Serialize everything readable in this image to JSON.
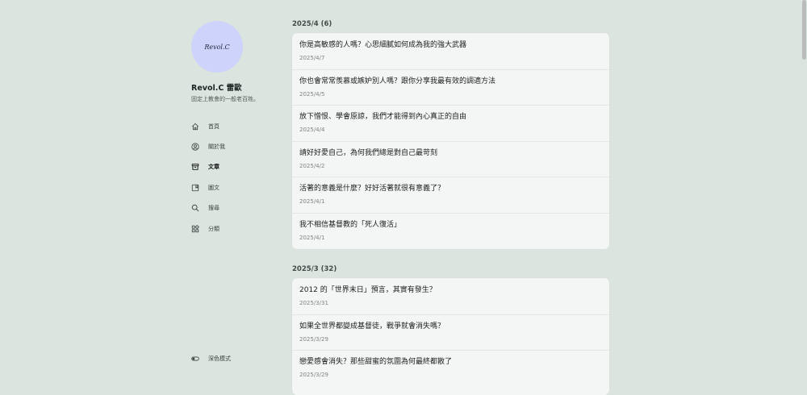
{
  "sidebar": {
    "avatar_text": "Revol.C",
    "site_name": "Revol.C 雷歐",
    "site_desc": "固定上教會的一般老百姓。",
    "nav": [
      {
        "label": "首頁",
        "icon": "home-icon"
      },
      {
        "label": "關於我",
        "icon": "user-circle-icon"
      },
      {
        "label": "文章",
        "icon": "archive-icon"
      },
      {
        "label": "圖文",
        "icon": "photo-icon"
      },
      {
        "label": "搜尋",
        "icon": "search-icon"
      },
      {
        "label": "分類",
        "icon": "categories-icon"
      }
    ],
    "active_nav": "文章",
    "dark_mode_label": "深色模式"
  },
  "archive": [
    {
      "heading": "2025/4 (6)",
      "posts": [
        {
          "title": "你是高敏感的人嗎？心思細膩如何成為我的強大武器",
          "date": "2025/4/7"
        },
        {
          "title": "你也會常常羨慕或嫉妒別人嗎？跟你分享我最有效的調適方法",
          "date": "2025/4/5"
        },
        {
          "title": "放下憎恨、學會原諒，我們才能得到內心真正的自由",
          "date": "2025/4/4"
        },
        {
          "title": "請好好愛自己，為何我們總是對自己最苛刻",
          "date": "2025/4/2"
        },
        {
          "title": "活著的意義是什麼？好好活著就很有意義了？",
          "date": "2025/4/1"
        },
        {
          "title": "我不相信基督教的「死人復活」",
          "date": "2025/4/1"
        }
      ]
    },
    {
      "heading": "2025/3 (32)",
      "posts": [
        {
          "title": "2012 的「世界末日」預言，其實有發生？",
          "date": "2025/3/31"
        },
        {
          "title": "如果全世界都變成基督徒，戰爭就會消失嗎？",
          "date": "2025/3/29"
        },
        {
          "title": "戀愛感會消失？那些甜蜜的氛圍為何最終都散了",
          "date": "2025/3/29"
        }
      ]
    }
  ],
  "colors": {
    "background": "#dce4df",
    "card": "#f3f6f4",
    "avatar": "#cdd3fb"
  }
}
